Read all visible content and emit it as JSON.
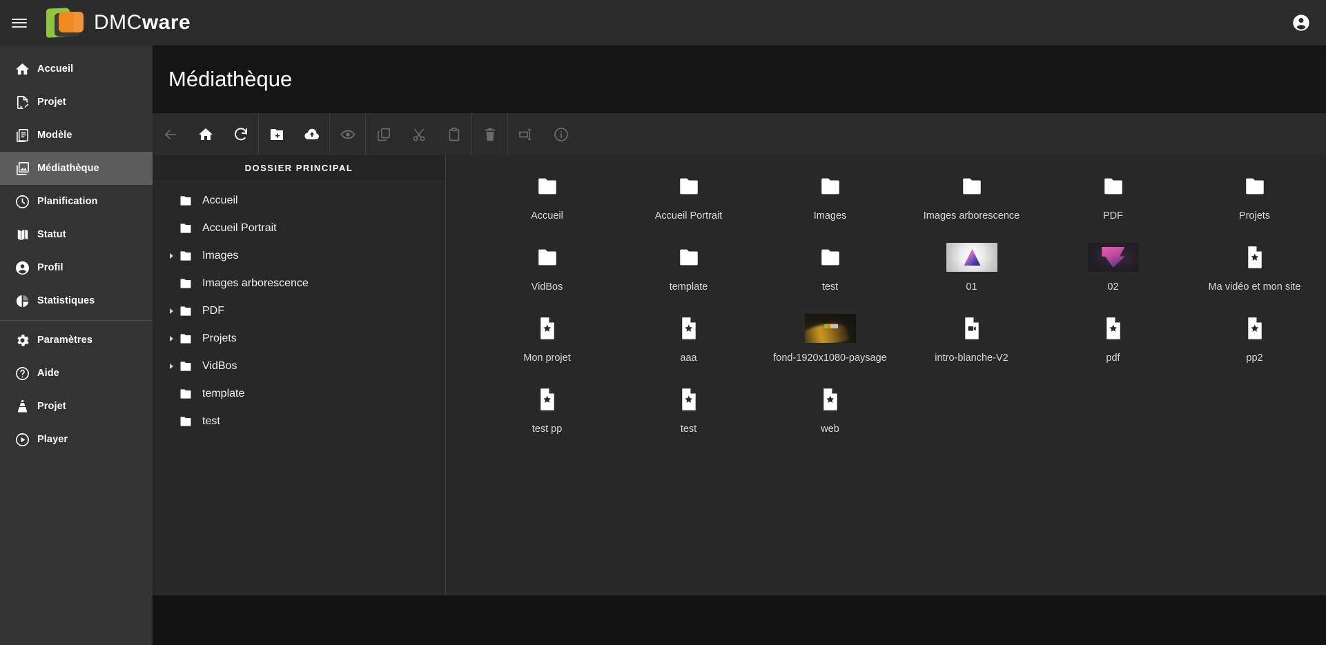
{
  "brand": {
    "name_light": "DMC",
    "name_bold": "ware",
    "logo_green": "#8dc63f",
    "logo_orange": "#f18a21",
    "menu_icon": "hamburger-icon",
    "account_icon": "account-circle-icon"
  },
  "header": {
    "title": "Médiathèque"
  },
  "sidebar": {
    "items": [
      {
        "label": "Accueil",
        "icon": "home-icon",
        "active": false
      },
      {
        "label": "Projet",
        "icon": "file-edit-icon",
        "active": false
      },
      {
        "label": "Modèle",
        "icon": "library-icon",
        "active": false
      },
      {
        "label": "Médiathèque",
        "icon": "photo-library-icon",
        "active": true
      },
      {
        "label": "Planification",
        "icon": "clock-icon",
        "active": false
      },
      {
        "label": "Statut",
        "icon": "map-icon",
        "active": false
      },
      {
        "label": "Profil",
        "icon": "account-icon",
        "active": false
      },
      {
        "label": "Statistiques",
        "icon": "pie-chart-icon",
        "active": false
      },
      {
        "label": "Paramètres",
        "icon": "gear-icon",
        "active": false
      },
      {
        "label": "Aide",
        "icon": "help-circle-icon",
        "active": false
      },
      {
        "label": "Projet",
        "icon": "vlc-cone-icon",
        "active": false
      },
      {
        "label": "Player",
        "icon": "play-circle-icon",
        "active": false
      }
    ],
    "divider_after_index": 7
  },
  "toolbar": {
    "groups": [
      {
        "buttons": [
          {
            "name": "back-button",
            "icon": "arrow-left-icon",
            "disabled": true
          },
          {
            "name": "home-button",
            "icon": "home-icon",
            "disabled": false
          },
          {
            "name": "refresh-button",
            "icon": "refresh-icon",
            "disabled": false
          }
        ]
      },
      {
        "buttons": [
          {
            "name": "new-folder-button",
            "icon": "folder-plus-icon",
            "disabled": false
          },
          {
            "name": "upload-button",
            "icon": "cloud-upload-icon",
            "disabled": false
          }
        ]
      },
      {
        "buttons": [
          {
            "name": "preview-button",
            "icon": "eye-icon",
            "disabled": true
          }
        ]
      },
      {
        "buttons": [
          {
            "name": "copy-button",
            "icon": "copy-icon",
            "disabled": true
          },
          {
            "name": "cut-button",
            "icon": "scissors-icon",
            "disabled": true
          },
          {
            "name": "paste-button",
            "icon": "clipboard-icon",
            "disabled": true
          }
        ]
      },
      {
        "buttons": [
          {
            "name": "delete-button",
            "icon": "trash-icon",
            "disabled": true
          }
        ]
      },
      {
        "buttons": [
          {
            "name": "rename-button",
            "icon": "rename-icon",
            "disabled": true
          },
          {
            "name": "info-button",
            "icon": "info-circle-icon",
            "disabled": true
          }
        ]
      }
    ]
  },
  "tree": {
    "header": "DOSSIER PRINCIPAL",
    "nodes": [
      {
        "label": "Accueil",
        "expandable": false
      },
      {
        "label": "Accueil Portrait",
        "expandable": false
      },
      {
        "label": "Images",
        "expandable": true
      },
      {
        "label": "Images arborescence",
        "expandable": false
      },
      {
        "label": "PDF",
        "expandable": true
      },
      {
        "label": "Projets",
        "expandable": true
      },
      {
        "label": "VidBos",
        "expandable": true
      },
      {
        "label": "template",
        "expandable": false
      },
      {
        "label": "test",
        "expandable": false
      }
    ]
  },
  "files": [
    {
      "label": "Accueil",
      "type": "folder"
    },
    {
      "label": "Accueil Portrait",
      "type": "folder"
    },
    {
      "label": "Images",
      "type": "folder"
    },
    {
      "label": "Images arborescence",
      "type": "folder"
    },
    {
      "label": "PDF",
      "type": "folder"
    },
    {
      "label": "Projets",
      "type": "folder"
    },
    {
      "label": "VidBos",
      "type": "folder"
    },
    {
      "label": "template",
      "type": "folder"
    },
    {
      "label": "test",
      "type": "folder"
    },
    {
      "label": "01",
      "type": "thumb",
      "thumb": "thumb-01"
    },
    {
      "label": "02",
      "type": "thumb",
      "thumb": "thumb-02"
    },
    {
      "label": "Ma vidéo et mon site",
      "type": "doc-star"
    },
    {
      "label": "Mon projet",
      "type": "doc-star"
    },
    {
      "label": "aaa",
      "type": "doc-star"
    },
    {
      "label": "fond-1920x1080-paysage",
      "type": "thumb",
      "thumb": "thumb-paysage"
    },
    {
      "label": "intro-blanche-V2",
      "type": "doc-video"
    },
    {
      "label": "pdf",
      "type": "doc-star"
    },
    {
      "label": "pp2",
      "type": "doc-star"
    },
    {
      "label": "test pp",
      "type": "doc-star"
    },
    {
      "label": "test",
      "type": "doc-star"
    },
    {
      "label": "web",
      "type": "doc-star"
    }
  ]
}
